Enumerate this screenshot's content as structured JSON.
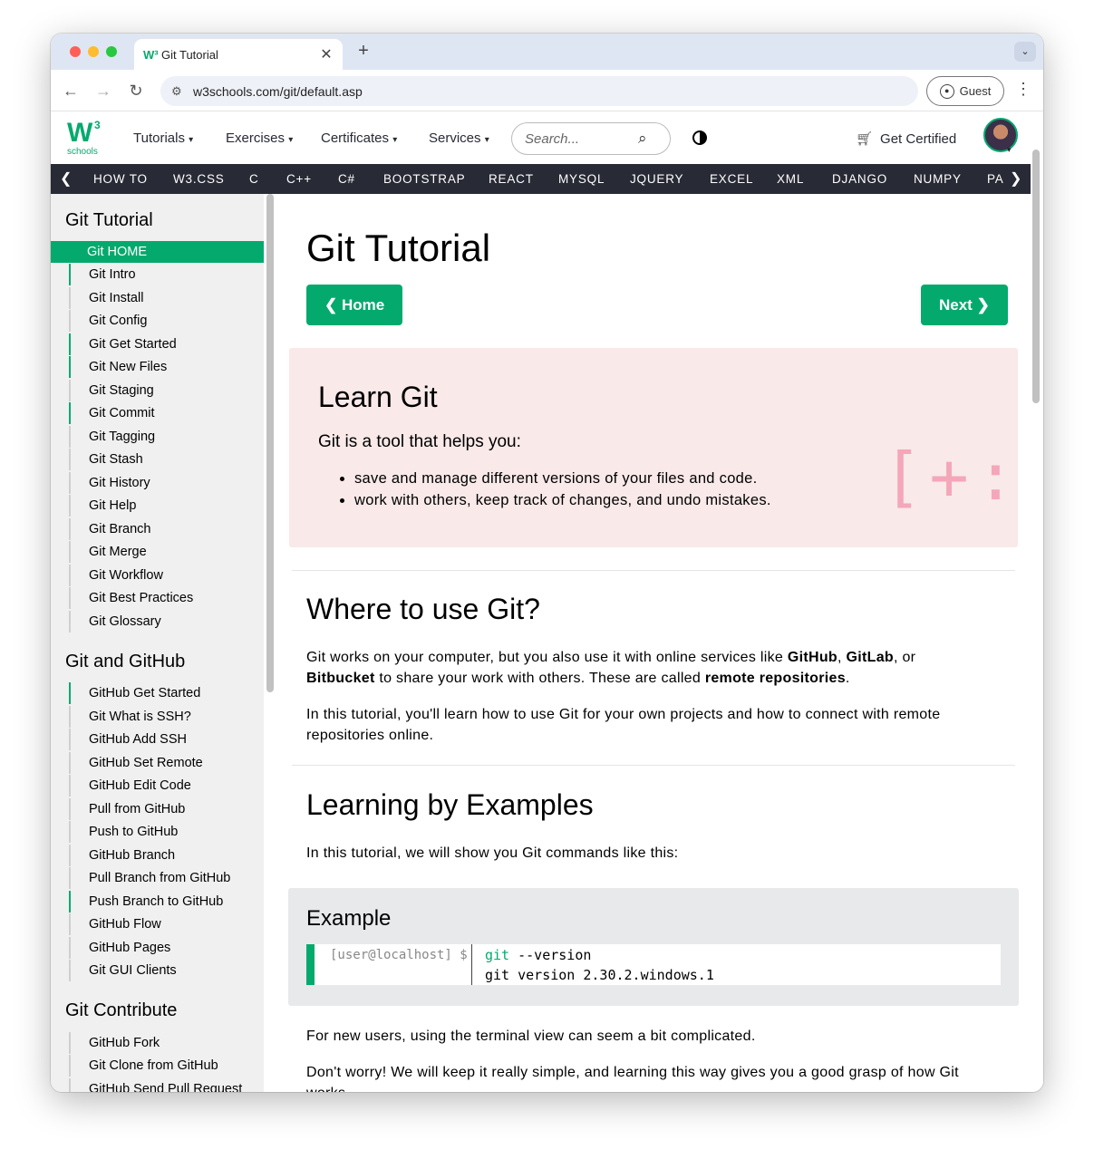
{
  "browser": {
    "tab_title": "Git Tutorial",
    "tab_favicon": "W³",
    "tab_close": "✕",
    "new_tab": "+",
    "url": "w3schools.com/git/default.asp",
    "guest_label": "Guest",
    "back": "←",
    "forward": "→",
    "reload": "↻",
    "kebab": "⋮",
    "tab_menu": "⌄"
  },
  "topnav": {
    "logo_main": "W",
    "logo_sup": "3",
    "logo_sub": "schools",
    "menus": [
      "Tutorials",
      "Exercises",
      "Certificates",
      "Services"
    ],
    "caret": "▾",
    "search_placeholder": "Search...",
    "get_certified": "Get Certified"
  },
  "subnav": {
    "left_arrow": "❮",
    "right_arrow": "❯",
    "items": [
      "HOW TO",
      "W3.CSS",
      "C",
      "C++",
      "C#",
      "BOOTSTRAP",
      "REACT",
      "MYSQL",
      "JQUERY",
      "EXCEL",
      "XML",
      "DJANGO",
      "NUMPY",
      "PA"
    ]
  },
  "sidebar": {
    "sections": [
      {
        "heading": "Git Tutorial",
        "items": [
          "Git HOME",
          "Git Intro",
          "Git Install",
          "Git Config",
          "Git Get Started",
          "Git New Files",
          "Git Staging",
          "Git Commit",
          "Git Tagging",
          "Git Stash",
          "Git History",
          "Git Help",
          "Git Branch",
          "Git Merge",
          "Git Workflow",
          "Git Best Practices",
          "Git Glossary"
        ]
      },
      {
        "heading": "Git and GitHub",
        "items": [
          "GitHub Get Started",
          "Git What is SSH?",
          "GitHub Add SSH",
          "GitHub Set Remote",
          "GitHub Edit Code",
          "Pull from GitHub",
          "Push to GitHub",
          "GitHub Branch",
          "Pull Branch from GitHub",
          "Push Branch to GitHub",
          "GitHub Flow",
          "GitHub Pages",
          "Git GUI Clients"
        ]
      },
      {
        "heading": "Git Contribute",
        "items": [
          "GitHub Fork",
          "Git Clone from GitHub",
          "GitHub Send Pull Request"
        ]
      }
    ]
  },
  "main": {
    "title": "Git Tutorial",
    "home_button": "❮ Home",
    "next_button": "Next ❯",
    "learn": {
      "title": "Learn Git",
      "lead": "Git is a tool that helps you:",
      "bullets": [
        "save and manage different versions of your files and code.",
        "work with others, keep track of changes, and undo mistakes."
      ],
      "deco": "[+:"
    },
    "where": {
      "title": "Where to use Git?",
      "p1_a": "Git works on your computer, but you also use it with online services like ",
      "p1_b": "GitHub",
      "p1_c": ", ",
      "p1_d": "GitLab",
      "p1_e": ", or ",
      "p1_f": "Bitbucket",
      "p1_g": " to share your work with others. These are called ",
      "p1_h": "remote repositories",
      "p1_i": ".",
      "p2": "In this tutorial, you'll learn how to use Git for your own projects and how to connect with remote repositories online."
    },
    "examples": {
      "title": "Learning by Examples",
      "p1": "In this tutorial, we will show you Git commands like this:",
      "example_title": "Example",
      "prompt": "[user@localhost] $",
      "cmd_git": "git",
      "cmd_rest": " --version",
      "output": "git version 2.30.2.windows.1",
      "p2": "For new users, using the terminal view can seem a bit complicated.",
      "p3": "Don't worry! We will keep it really simple, and learning this way gives you a good grasp of how Git works."
    }
  }
}
